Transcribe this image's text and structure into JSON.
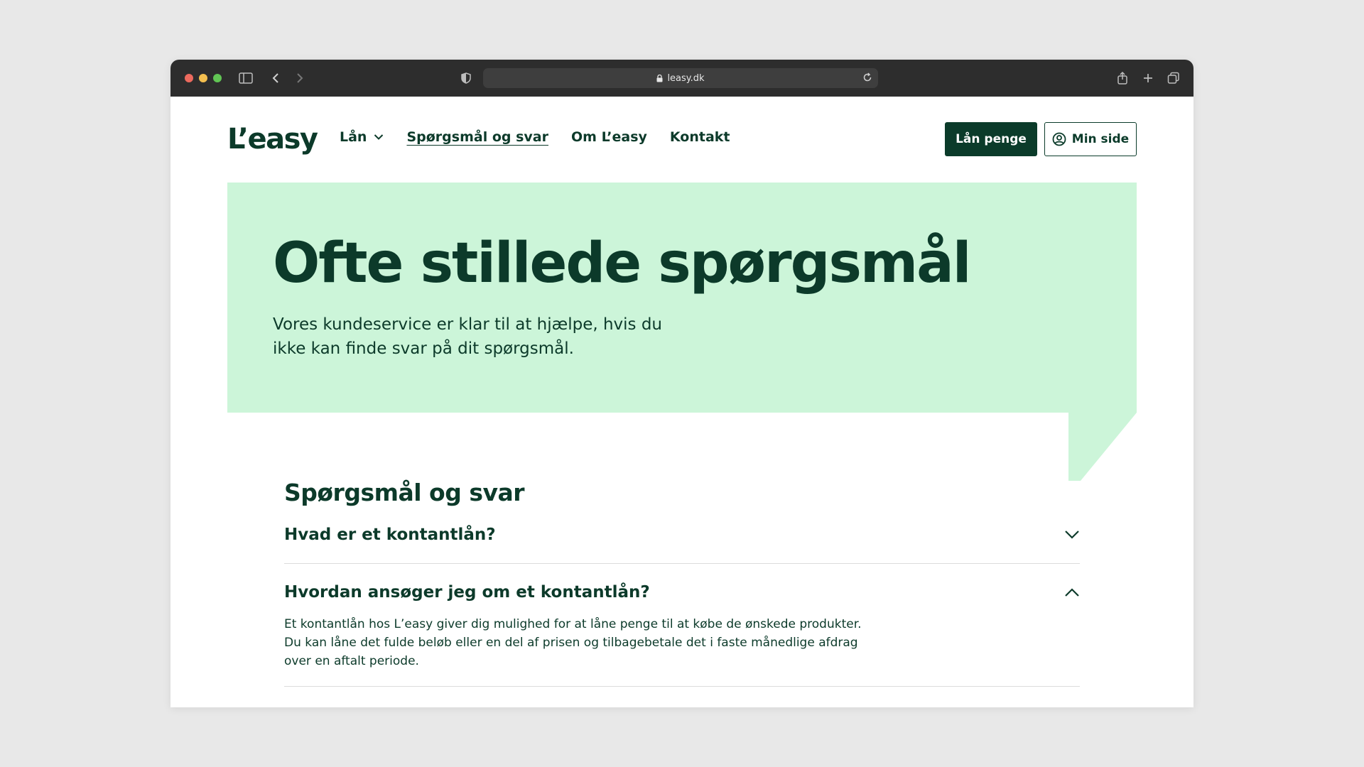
{
  "browser": {
    "url": "leasy.dk"
  },
  "nav": {
    "logo": "L’easy",
    "links": [
      {
        "label": "Lån"
      },
      {
        "label": "Spørgsmål og svar"
      },
      {
        "label": "Om L’easy"
      },
      {
        "label": "Kontakt"
      }
    ],
    "cta_primary": "Lån penge",
    "cta_secondary": "Min side"
  },
  "hero": {
    "title": "Ofte stillede spørgsmål",
    "text": "Vores kundeservice er klar til at hjælpe, hvis du ikke kan finde svar på dit spørgsmål."
  },
  "faq": {
    "heading": "Spørgsmål og svar",
    "items": [
      {
        "question": "Hvad er et kontantlån?",
        "expanded": false
      },
      {
        "question": "Hvordan ansøger jeg om et kontantlån?",
        "expanded": true,
        "answer": "Et kontantlån hos L’easy giver dig mulighed for at låne penge til at købe de ønskede produkter. Du kan låne det fulde beløb eller en del af prisen og tilbagebetale det i faste månedlige afdrag over en aftalt periode."
      }
    ]
  },
  "colors": {
    "brand_dark": "#0b3b2a",
    "hero_bg": "#ccf5d9",
    "titlebar": "#2d2d2d"
  }
}
